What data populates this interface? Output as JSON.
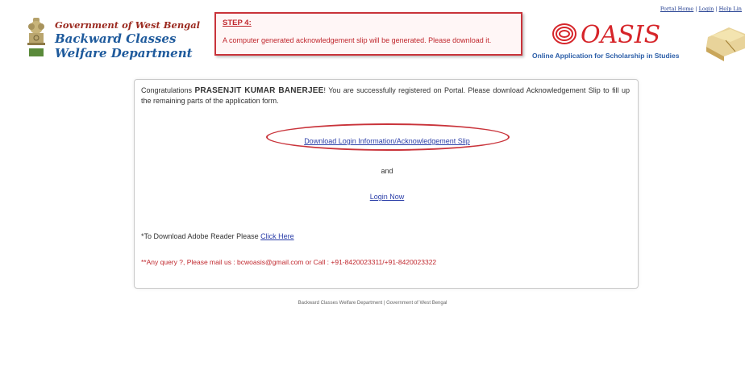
{
  "header": {
    "dept_line1": "Government of West Bengal",
    "dept_line2": "Backward Classes",
    "dept_line3": "Welfare Department",
    "top_links": [
      "Portal Home",
      "Login",
      "Help Lin"
    ],
    "logo_text": "OASIS",
    "logo_tagline": "Online Application for Scholarship in Studies"
  },
  "step": {
    "title": "STEP 4:",
    "text": "A computer generated acknowledgement slip will be generated. Please download it."
  },
  "content": {
    "congrats_prefix": "Congratulations",
    "user_name": "PRASENJIT KUMAR BANERJEE",
    "congrats_suffix": "! You are successfully registered on Portal. Please download Acknowledgement Slip to fill up the remaining parts of the application form.",
    "download_link": "Download Login Information/Acknowledgement Slip",
    "and_text": "and",
    "login_link": "Login Now",
    "adobe_prefix": "*To Download Adobe Reader Please",
    "adobe_link": "Click Here",
    "query_text": "**Any query ?, Please mail us : bcwoasis@gmail.com or Call : +91-8420023311/+91-8420023322"
  },
  "footer": {
    "text": "Backward Classes Welfare Department | Government of West Bengal"
  },
  "colors": {
    "accent_red": "#c9333a",
    "link_blue": "#2b3ea8",
    "dept_blue": "#1e5a9c",
    "dept_maroon": "#9b2a20"
  }
}
